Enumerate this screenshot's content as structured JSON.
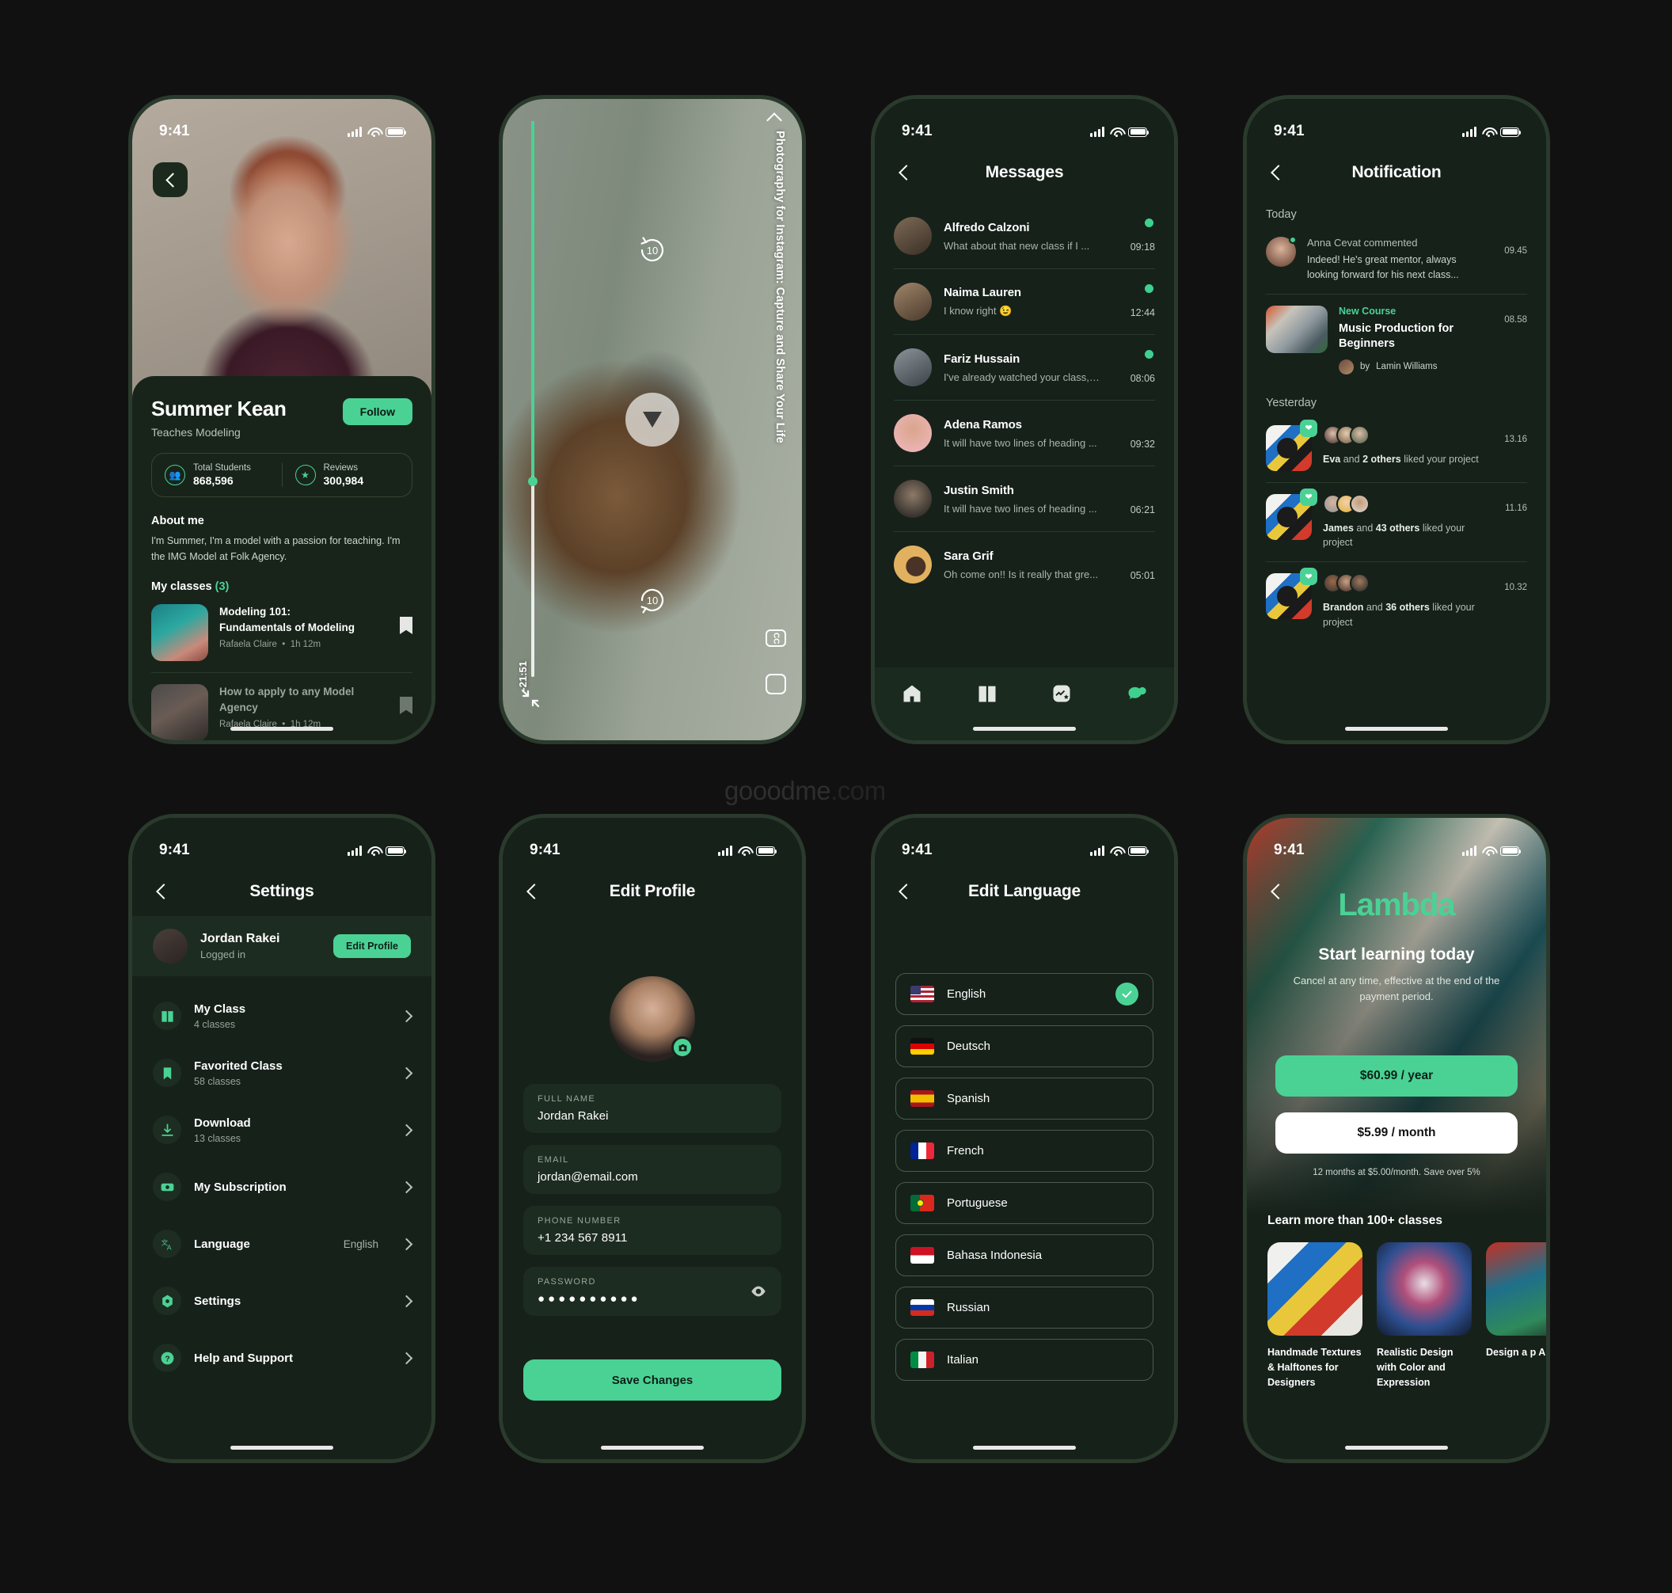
{
  "watermark": {
    "brand": "gooodme",
    "tld": ".com"
  },
  "status_bar": {
    "time": "9:41"
  },
  "profile_screen": {
    "back_icon": "chevron-left-icon",
    "name": "Summer Kean",
    "subtitle": "Teaches Modeling",
    "follow_label": "Follow",
    "stats": [
      {
        "icon": "people-icon",
        "label": "Total Students",
        "value": "868,596"
      },
      {
        "icon": "star-icon",
        "label": "Reviews",
        "value": "300,984"
      }
    ],
    "about_heading": "About me",
    "about_text": "I'm Summer, I'm a model with a passion for teaching. I'm the IMG Model at Folk Agency.",
    "classes_heading": "My classes",
    "classes_count": "(3)",
    "classes": [
      {
        "title_line1": "Modeling 101:",
        "title_line2": "Fundamentals of Modeling",
        "author": "Rafaela Claire",
        "duration": "1h 12m",
        "bookmark_icon": "bookmark-icon"
      },
      {
        "title_line1": "How to apply to any Model",
        "title_line2": "Agency",
        "author": "Rafaela Claire",
        "duration": "1h 12m",
        "bookmark_icon": "bookmark-icon"
      }
    ]
  },
  "video_screen": {
    "title": "Photography for Instagram: Capture and Share Your Life",
    "remaining_time": "-21:51",
    "play_icon": "play-icon",
    "forward_icon": "forward-10-icon",
    "backward_icon": "replay-10-icon",
    "cc_label": "CC",
    "fullscreen_icon": "fullscreen-icon",
    "minimize_icon": "minimize-icon",
    "back_icon": "chevron-left-icon",
    "progress_percent": 64
  },
  "messages_screen": {
    "title": "Messages",
    "back_icon": "chevron-left-icon",
    "items": [
      {
        "name": "Alfredo Calzoni",
        "preview": "What about that new class if I ...",
        "time": "09:18",
        "unread": true,
        "avatar_color": "#6c5a48"
      },
      {
        "name": "Naima Lauren",
        "preview": "I know right 😉",
        "time": "12:44",
        "unread": true,
        "avatar_color": "#8a6a52"
      },
      {
        "name": "Fariz Hussain",
        "preview": "I've already watched your class, c...",
        "time": "08:06",
        "unread": true,
        "avatar_color": "#5d6a70"
      },
      {
        "name": "Adena Ramos",
        "preview": "It will have two lines of heading ...",
        "time": "09:32",
        "unread": false,
        "avatar_color": "#f0b9c0"
      },
      {
        "name": "Justin Smith",
        "preview": "It will have two lines of heading ...",
        "time": "06:21",
        "unread": false,
        "avatar_color": "#2a2a2a"
      },
      {
        "name": "Sara Grif",
        "preview": "Oh come on!! Is it really that gre...",
        "time": "05:01",
        "unread": false,
        "avatar_color": "#e2b15f"
      }
    ],
    "tabs": [
      {
        "icon": "home-icon",
        "active": false
      },
      {
        "icon": "book-icon",
        "active": false
      },
      {
        "icon": "discover-icon",
        "active": false
      },
      {
        "icon": "chat-icon",
        "active": true
      }
    ]
  },
  "notification_screen": {
    "title": "Notification",
    "back_icon": "chevron-left-icon",
    "section_today": "Today",
    "section_yesterday": "Yesterday",
    "today": [
      {
        "type": "comment",
        "user": "Anna Cevat",
        "action": "commented",
        "text": "Indeed! He's great mentor, always looking forward for his next class...",
        "time": "09.45"
      },
      {
        "type": "course",
        "tag": "New Course",
        "title": "Music Production for Beginners",
        "by_prefix": "by",
        "author": "Lamin Williams",
        "time": "08.58"
      }
    ],
    "yesterday": [
      {
        "type": "like",
        "name": "Eva",
        "middle": "and",
        "others": "2 others",
        "suffix": "liked your project",
        "time": "13.16",
        "badge_icon": "heart-icon"
      },
      {
        "type": "like",
        "name": "James",
        "middle": "and",
        "others": "43 others",
        "suffix": "liked your project",
        "time": "11.16",
        "badge_icon": "heart-icon"
      },
      {
        "type": "like",
        "name": "Brandon",
        "middle": "and",
        "others": "36 others",
        "suffix": "liked your project",
        "time": "10.32",
        "badge_icon": "heart-icon"
      }
    ]
  },
  "settings_screen": {
    "title": "Settings",
    "back_icon": "chevron-left-icon",
    "user_name": "Jordan Rakei",
    "user_status": "Logged in",
    "edit_profile_label": "Edit Profile",
    "items": [
      {
        "icon": "book-icon",
        "label": "My Class",
        "sub": "4 classes",
        "value": ""
      },
      {
        "icon": "bookmark-icon",
        "label": "Favorited Class",
        "sub": "58 classes",
        "value": ""
      },
      {
        "icon": "download-icon",
        "label": "Download",
        "sub": "13 classes",
        "value": ""
      },
      {
        "icon": "money-icon",
        "label": "My Subscription",
        "sub": "",
        "value": ""
      },
      {
        "icon": "translate-icon",
        "label": "Language",
        "sub": "",
        "value": "English"
      },
      {
        "icon": "gear-icon",
        "label": "Settings",
        "sub": "",
        "value": ""
      },
      {
        "icon": "help-icon",
        "label": "Help and Support",
        "sub": "",
        "value": ""
      }
    ]
  },
  "edit_profile_screen": {
    "title": "Edit Profile",
    "back_icon": "chevron-left-icon",
    "camera_icon": "camera-icon",
    "fields": [
      {
        "label": "FULL NAME",
        "value": "Jordan Rakei"
      },
      {
        "label": "EMAIL",
        "value": "jordan@email.com"
      },
      {
        "label": "PHONE NUMBER",
        "value": "+1 234 567 8911"
      },
      {
        "label": "PASSWORD",
        "value": "●●●●●●●●●●",
        "trailing_icon": "eye-icon"
      }
    ],
    "save_label": "Save Changes"
  },
  "language_screen": {
    "title": "Edit Language",
    "back_icon": "chevron-left-icon",
    "check_icon": "check-icon",
    "languages": [
      {
        "name": "English",
        "flag": "us",
        "selected": true
      },
      {
        "name": "Deutsch",
        "flag": "de",
        "selected": false
      },
      {
        "name": "Spanish",
        "flag": "es",
        "selected": false
      },
      {
        "name": "French",
        "flag": "fr",
        "selected": false
      },
      {
        "name": "Portuguese",
        "flag": "pt",
        "selected": false
      },
      {
        "name": "Bahasa Indonesia",
        "flag": "id",
        "selected": false
      },
      {
        "name": "Russian",
        "flag": "ru",
        "selected": false
      },
      {
        "name": "Italian",
        "flag": "it",
        "selected": false
      }
    ]
  },
  "subscribe_screen": {
    "back_icon": "chevron-left-icon",
    "brand": "Lambda",
    "headline": "Start learning today",
    "subtext": "Cancel at any time, effective at the end of the payment period.",
    "price_year": "$60.99 / year",
    "price_month": "$5.99 / month",
    "note": "12 months at $5.00/month. Save over 5%",
    "learn_heading": "Learn more than 100+ classes",
    "cards": [
      {
        "title": "Handmade Textures & Halftones for Designers"
      },
      {
        "title": "Realistic Design with Color and Expression"
      },
      {
        "title": "Design a p Abstract"
      }
    ]
  },
  "colors": {
    "accent": "#4ad295",
    "screen_bg": "#16211a",
    "card_bg": "#1d2c20",
    "frame": "#2a3a2c"
  }
}
